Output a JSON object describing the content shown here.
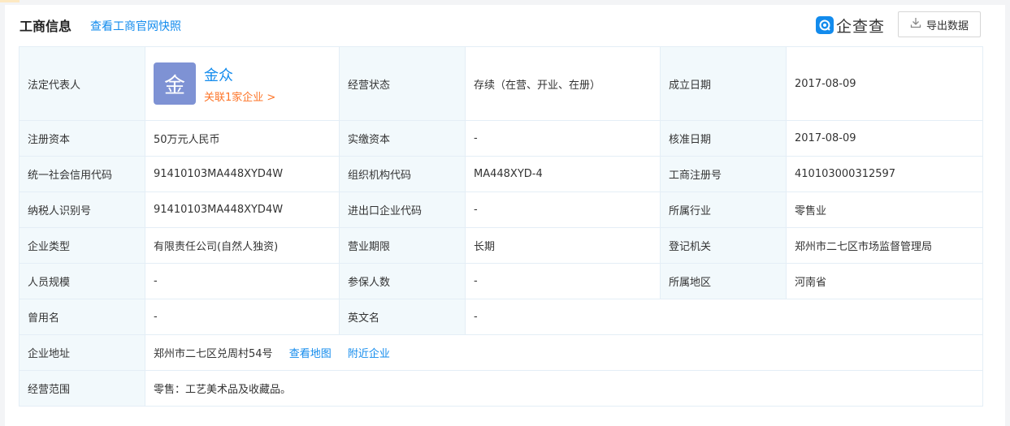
{
  "header": {
    "title": "工商信息",
    "snapshot_link": "查看工商官网快照",
    "brand_name": "企查查",
    "export_label": "导出数据"
  },
  "legal_rep": {
    "label": "法定代表人",
    "avatar_char": "金",
    "name": "金众",
    "related": "关联1家企业 >"
  },
  "fields": {
    "status_label": "经营状态",
    "status_value": "存续（在营、开业、在册）",
    "founded_label": "成立日期",
    "founded_value": "2017-08-09",
    "reg_capital_label": "注册资本",
    "reg_capital_value": "50万元人民币",
    "paid_capital_label": "实缴资本",
    "paid_capital_value": "-",
    "approved_label": "核准日期",
    "approved_value": "2017-08-09",
    "credit_code_label": "统一社会信用代码",
    "credit_code_value": "91410103MA448XYD4W",
    "org_code_label": "组织机构代码",
    "org_code_value": "MA448XYD-4",
    "reg_no_label": "工商注册号",
    "reg_no_value": "410103000312597",
    "taxpayer_label": "纳税人识别号",
    "taxpayer_value": "91410103MA448XYD4W",
    "import_export_label": "进出口企业代码",
    "import_export_value": "-",
    "industry_label": "所属行业",
    "industry_value": "零售业",
    "type_label": "企业类型",
    "type_value": "有限责任公司(自然人独资)",
    "term_label": "营业期限",
    "term_value": "长期",
    "authority_label": "登记机关",
    "authority_value": "郑州市二七区市场监督管理局",
    "staff_label": "人员规模",
    "staff_value": "-",
    "insured_label": "参保人数",
    "insured_value": "-",
    "region_label": "所属地区",
    "region_value": "河南省",
    "former_name_label": "曾用名",
    "former_name_value": "-",
    "english_name_label": "英文名",
    "english_name_value": "-",
    "address_label": "企业地址",
    "address_value": "郑州市二七区兑周村54号",
    "view_map": "查看地图",
    "nearby": "附近企业",
    "scope_label": "经营范围",
    "scope_value": "零售：工艺美术品及收藏品。"
  },
  "colors": {
    "link_blue": "#128bed",
    "orange": "#fd7427",
    "avatar_bg": "#7e92d4",
    "label_bg": "#f2f9fc"
  }
}
